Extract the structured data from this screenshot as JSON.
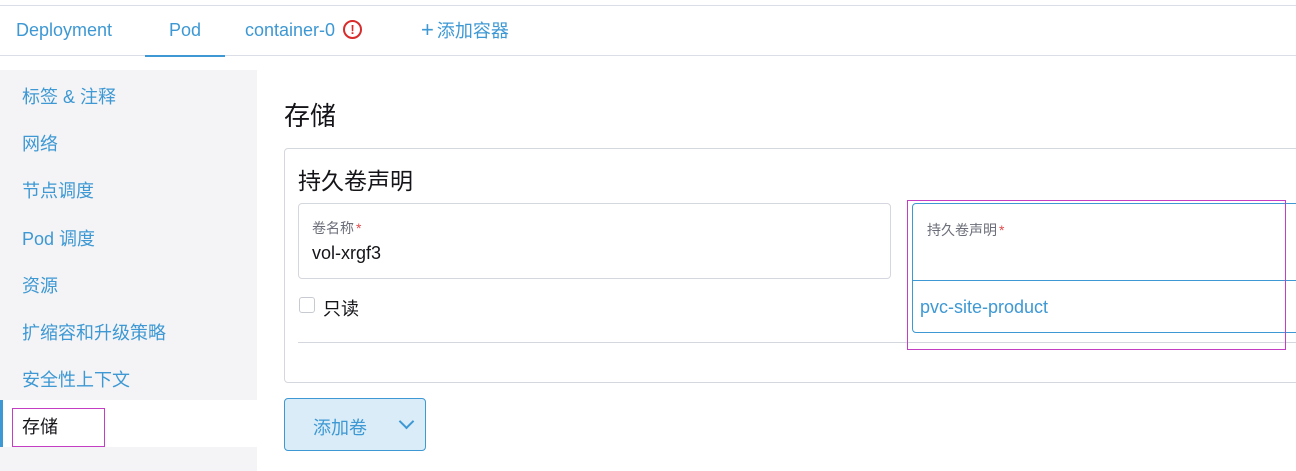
{
  "tabs": [
    {
      "label": "Deployment"
    },
    {
      "label": "Pod",
      "active": true
    },
    {
      "label": "container-0",
      "badge": "!"
    },
    {
      "label": "添加容器",
      "icon": "+"
    }
  ],
  "sidebar": {
    "items": [
      {
        "label": "标签 & 注释"
      },
      {
        "label": "网络"
      },
      {
        "label": "节点调度"
      },
      {
        "label": "Pod 调度"
      },
      {
        "label": "资源"
      },
      {
        "label": "扩缩容和升级策略"
      },
      {
        "label": "安全性上下文"
      },
      {
        "label": "存储",
        "active": true
      }
    ]
  },
  "main": {
    "title": "存储",
    "card": {
      "title": "持久卷声明",
      "volume_name": {
        "label": "卷名称",
        "required": "*",
        "value": "vol-xrgf3"
      },
      "readonly": {
        "label": "只读",
        "checked": false
      },
      "pvc": {
        "label": "持久卷声明",
        "required": "*",
        "value": "pvc-site-product"
      }
    },
    "add_volume_button": "添加卷"
  },
  "colors": {
    "accent": "#3d98d3",
    "error": "#d92b2b",
    "highlight": "#c43ec4"
  }
}
